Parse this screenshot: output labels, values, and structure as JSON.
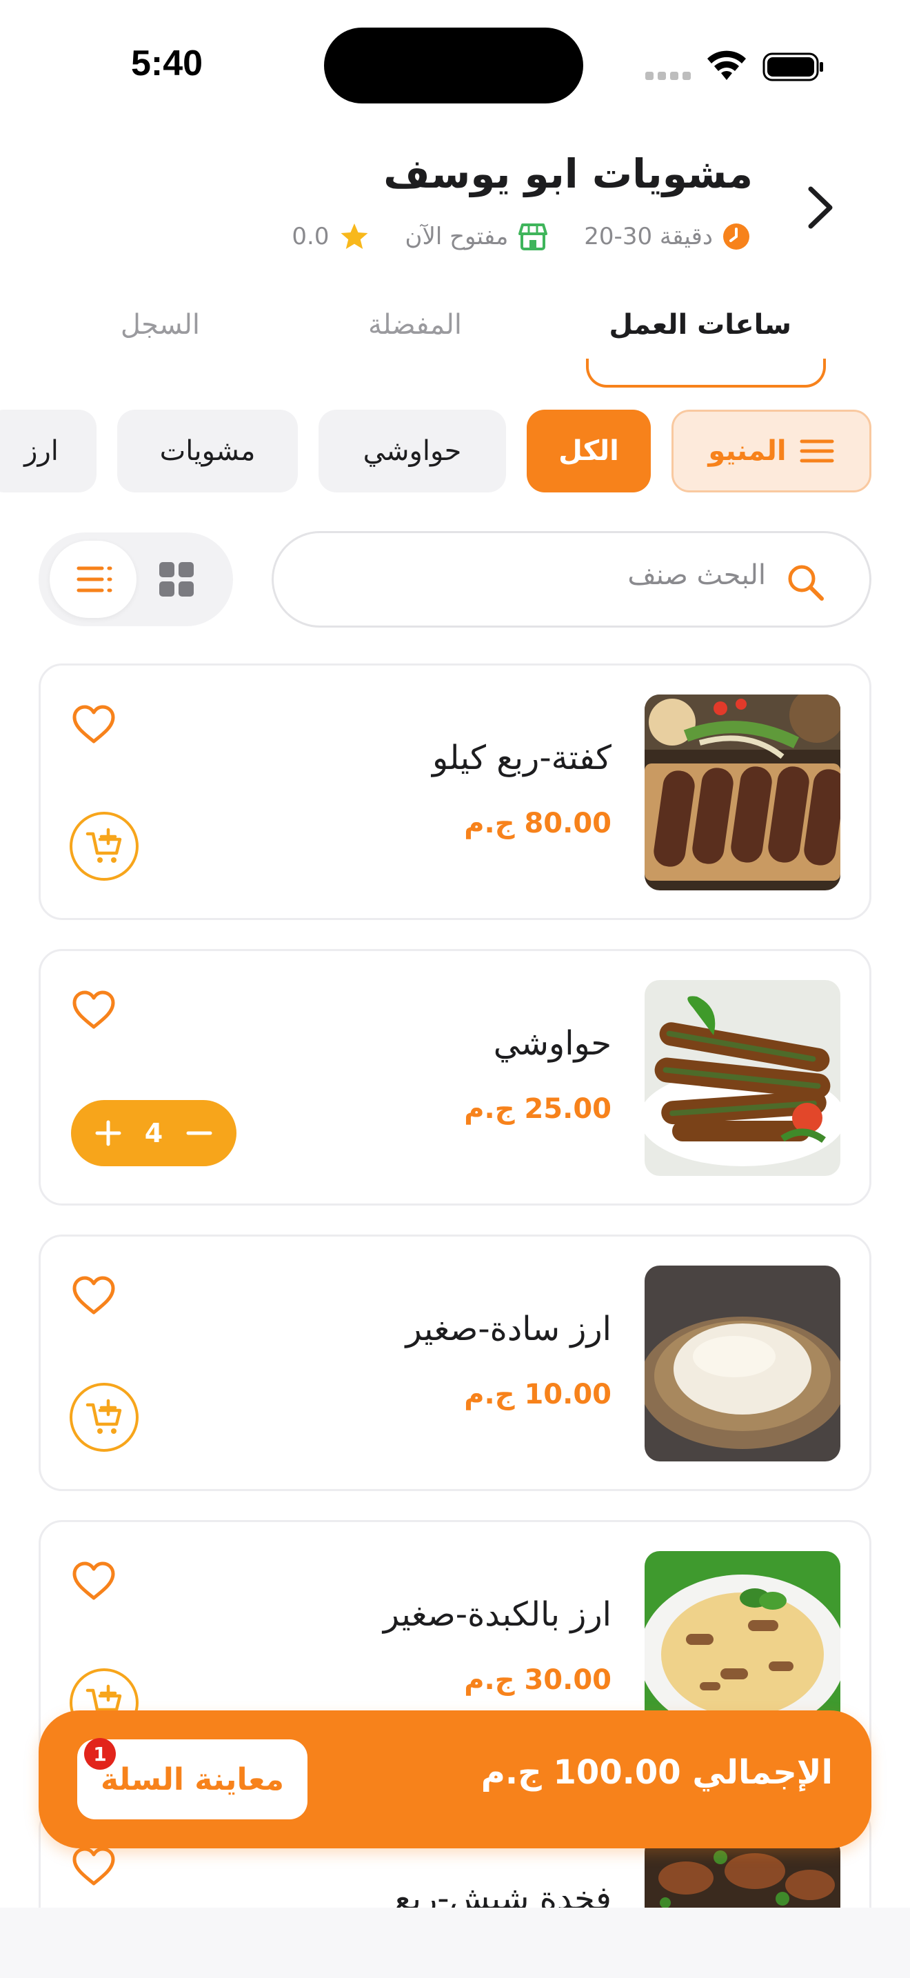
{
  "status_bar": {
    "time": "5:40"
  },
  "restaurant": {
    "name": "مشويات ابو يوسف",
    "delivery_time": "20-30 دقيقة",
    "open_status": "مفتوح الآن",
    "rating": "0.0"
  },
  "tabs": [
    {
      "label": "ساعات العمل",
      "active": true
    },
    {
      "label": "المفضلة",
      "active": false
    },
    {
      "label": "السجل",
      "active": false
    }
  ],
  "categories": {
    "menu_label": "المنيو",
    "items": [
      {
        "label": "الكل",
        "active": true
      },
      {
        "label": "حواوشي",
        "active": false
      },
      {
        "label": "مشويات",
        "active": false
      },
      {
        "label": "ارز",
        "active": false
      }
    ]
  },
  "search": {
    "placeholder": "البحث صنف"
  },
  "products": [
    {
      "name": "كفتة-ربع كيلو",
      "price": "80.00 ج.م",
      "quantity": null
    },
    {
      "name": "حواوشي",
      "price": "25.00 ج.م",
      "quantity": "4"
    },
    {
      "name": "ارز سادة-صغير",
      "price": "10.00 ج.م",
      "quantity": null
    },
    {
      "name": "ارز بالكبدة-صغير",
      "price": "30.00 ج.م",
      "quantity": null
    },
    {
      "name": "فخدة شيش-ربع",
      "price": "",
      "quantity": null
    }
  ],
  "cart": {
    "total_label": "الإجمالي 100.00 ج.م",
    "button_label": "معاينة السلة",
    "badge_count": "1"
  },
  "colors": {
    "accent": "#f7821b",
    "accent_light": "#f7a51b",
    "badge": "#e2241b"
  }
}
